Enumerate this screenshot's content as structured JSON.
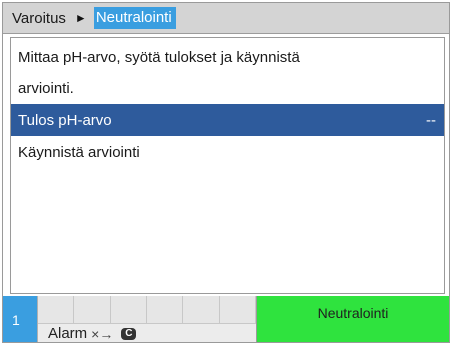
{
  "breadcrumb": {
    "parent": "Varoitus",
    "separator": "►",
    "current": "Neutralointi"
  },
  "content": {
    "message_line1": "Mittaa pH-arvo, syötä tulokset ja käynnistä",
    "message_line2": "arviointi.",
    "items": [
      {
        "label": "Tulos pH-arvo",
        "value": "--",
        "selected": true
      },
      {
        "label": "Käynnistä arviointi",
        "value": "",
        "selected": false
      }
    ]
  },
  "statusbar": {
    "channel": "1",
    "alarm_label": "Alarm",
    "alarm_glyph": "×→",
    "alarm_key": "C",
    "status_text": "Neutralointi"
  },
  "colors": {
    "accent": "#3a9ee0",
    "selected_row": "#2e5b9c",
    "status_green": "#2fe33e"
  }
}
